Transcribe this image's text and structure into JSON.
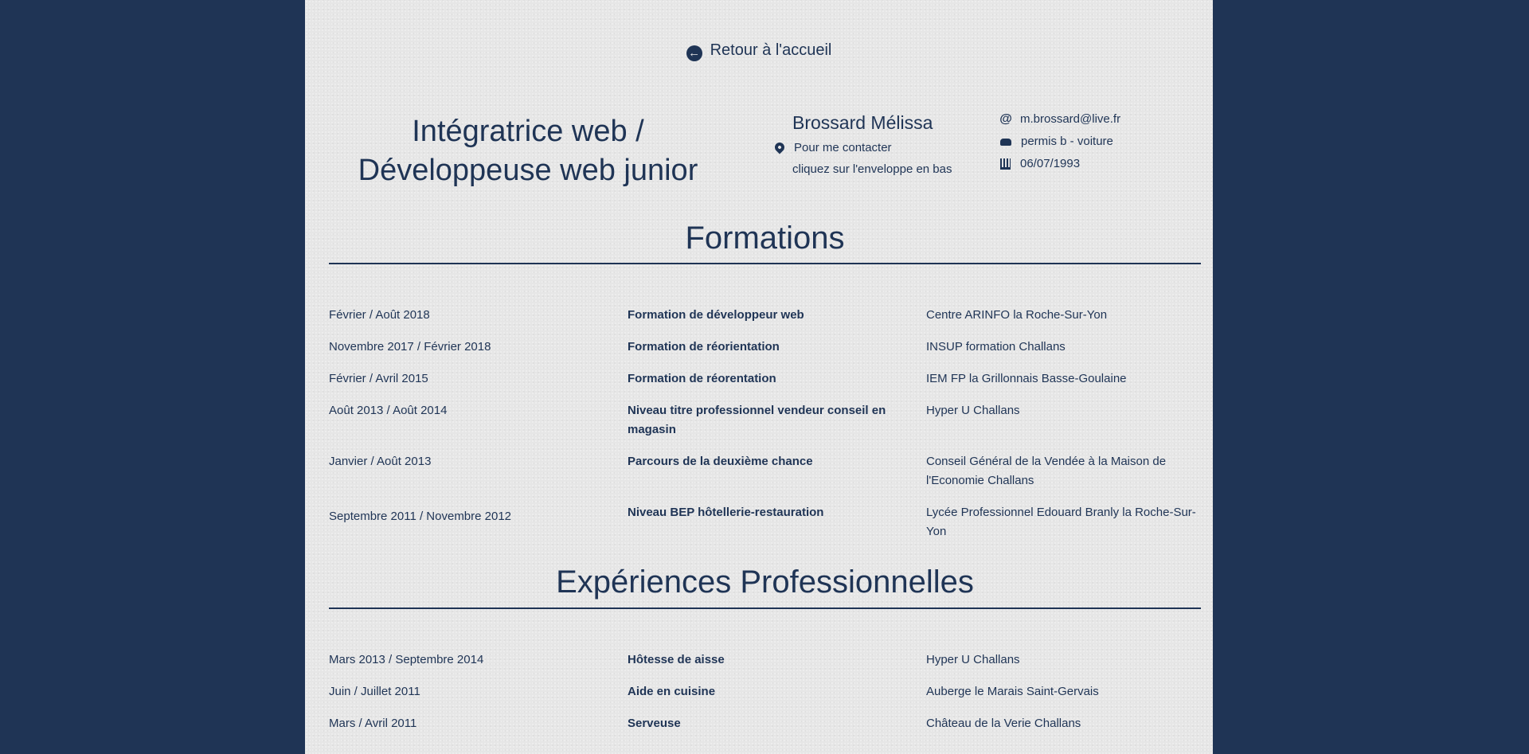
{
  "nav": {
    "back_label": "Retour à l'accueil",
    "back_icon": "circle-arrow-left-icon"
  },
  "header": {
    "job_title_line1": "Intégratrice web /",
    "job_title_line2": "Développeuse web junior",
    "name": "Brossard Mélissa",
    "contact_line1": "Pour me contacter",
    "contact_line2": "cliquez sur l'enveloppe en bas",
    "email": "m.brossard@live.fr",
    "license": "permis b - voiture",
    "birthdate": "06/07/1993"
  },
  "formations": {
    "title": "Formations",
    "rows": [
      {
        "date": "Février / Août 2018",
        "title": "Formation de développeur web",
        "place": "Centre ARINFO la Roche-Sur-Yon"
      },
      {
        "date": "Novembre 2017 / Février 2018",
        "title": "Formation de réorientation",
        "place": "INSUP formation Challans"
      },
      {
        "date": "Février / Avril 2015",
        "title": "Formation de réorentation",
        "place": "IEM FP la Grillonnais Basse-Goulaine"
      },
      {
        "date": "Août 2013 / Août 2014",
        "title": "Niveau titre professionnel vendeur conseil en magasin",
        "place": "Hyper U Challans"
      },
      {
        "date": "Janvier / Août 2013",
        "title": "Parcours de la deuxième chance",
        "place": "Conseil Général de la Vendée à la Maison de l'Economie Challans"
      },
      {
        "date": "Septembre 2011 / Novembre 2012",
        "title": "Niveau BEP hôtellerie-restauration",
        "place": "Lycée Professionnel Edouard Branly la Roche-Sur-Yon"
      }
    ]
  },
  "experiences": {
    "title": "Expériences Professionnelles",
    "rows": [
      {
        "date": "Mars 2013 / Septembre 2014",
        "title": "Hôtesse de aisse",
        "place": "Hyper U Challans"
      },
      {
        "date": "Juin / Juillet 2011",
        "title": "Aide en cuisine",
        "place": "Auberge le Marais Saint-Gervais"
      },
      {
        "date": "Mars / Avril 2011",
        "title": "Serveuse",
        "place": "Château de la Verie Challans"
      }
    ]
  }
}
